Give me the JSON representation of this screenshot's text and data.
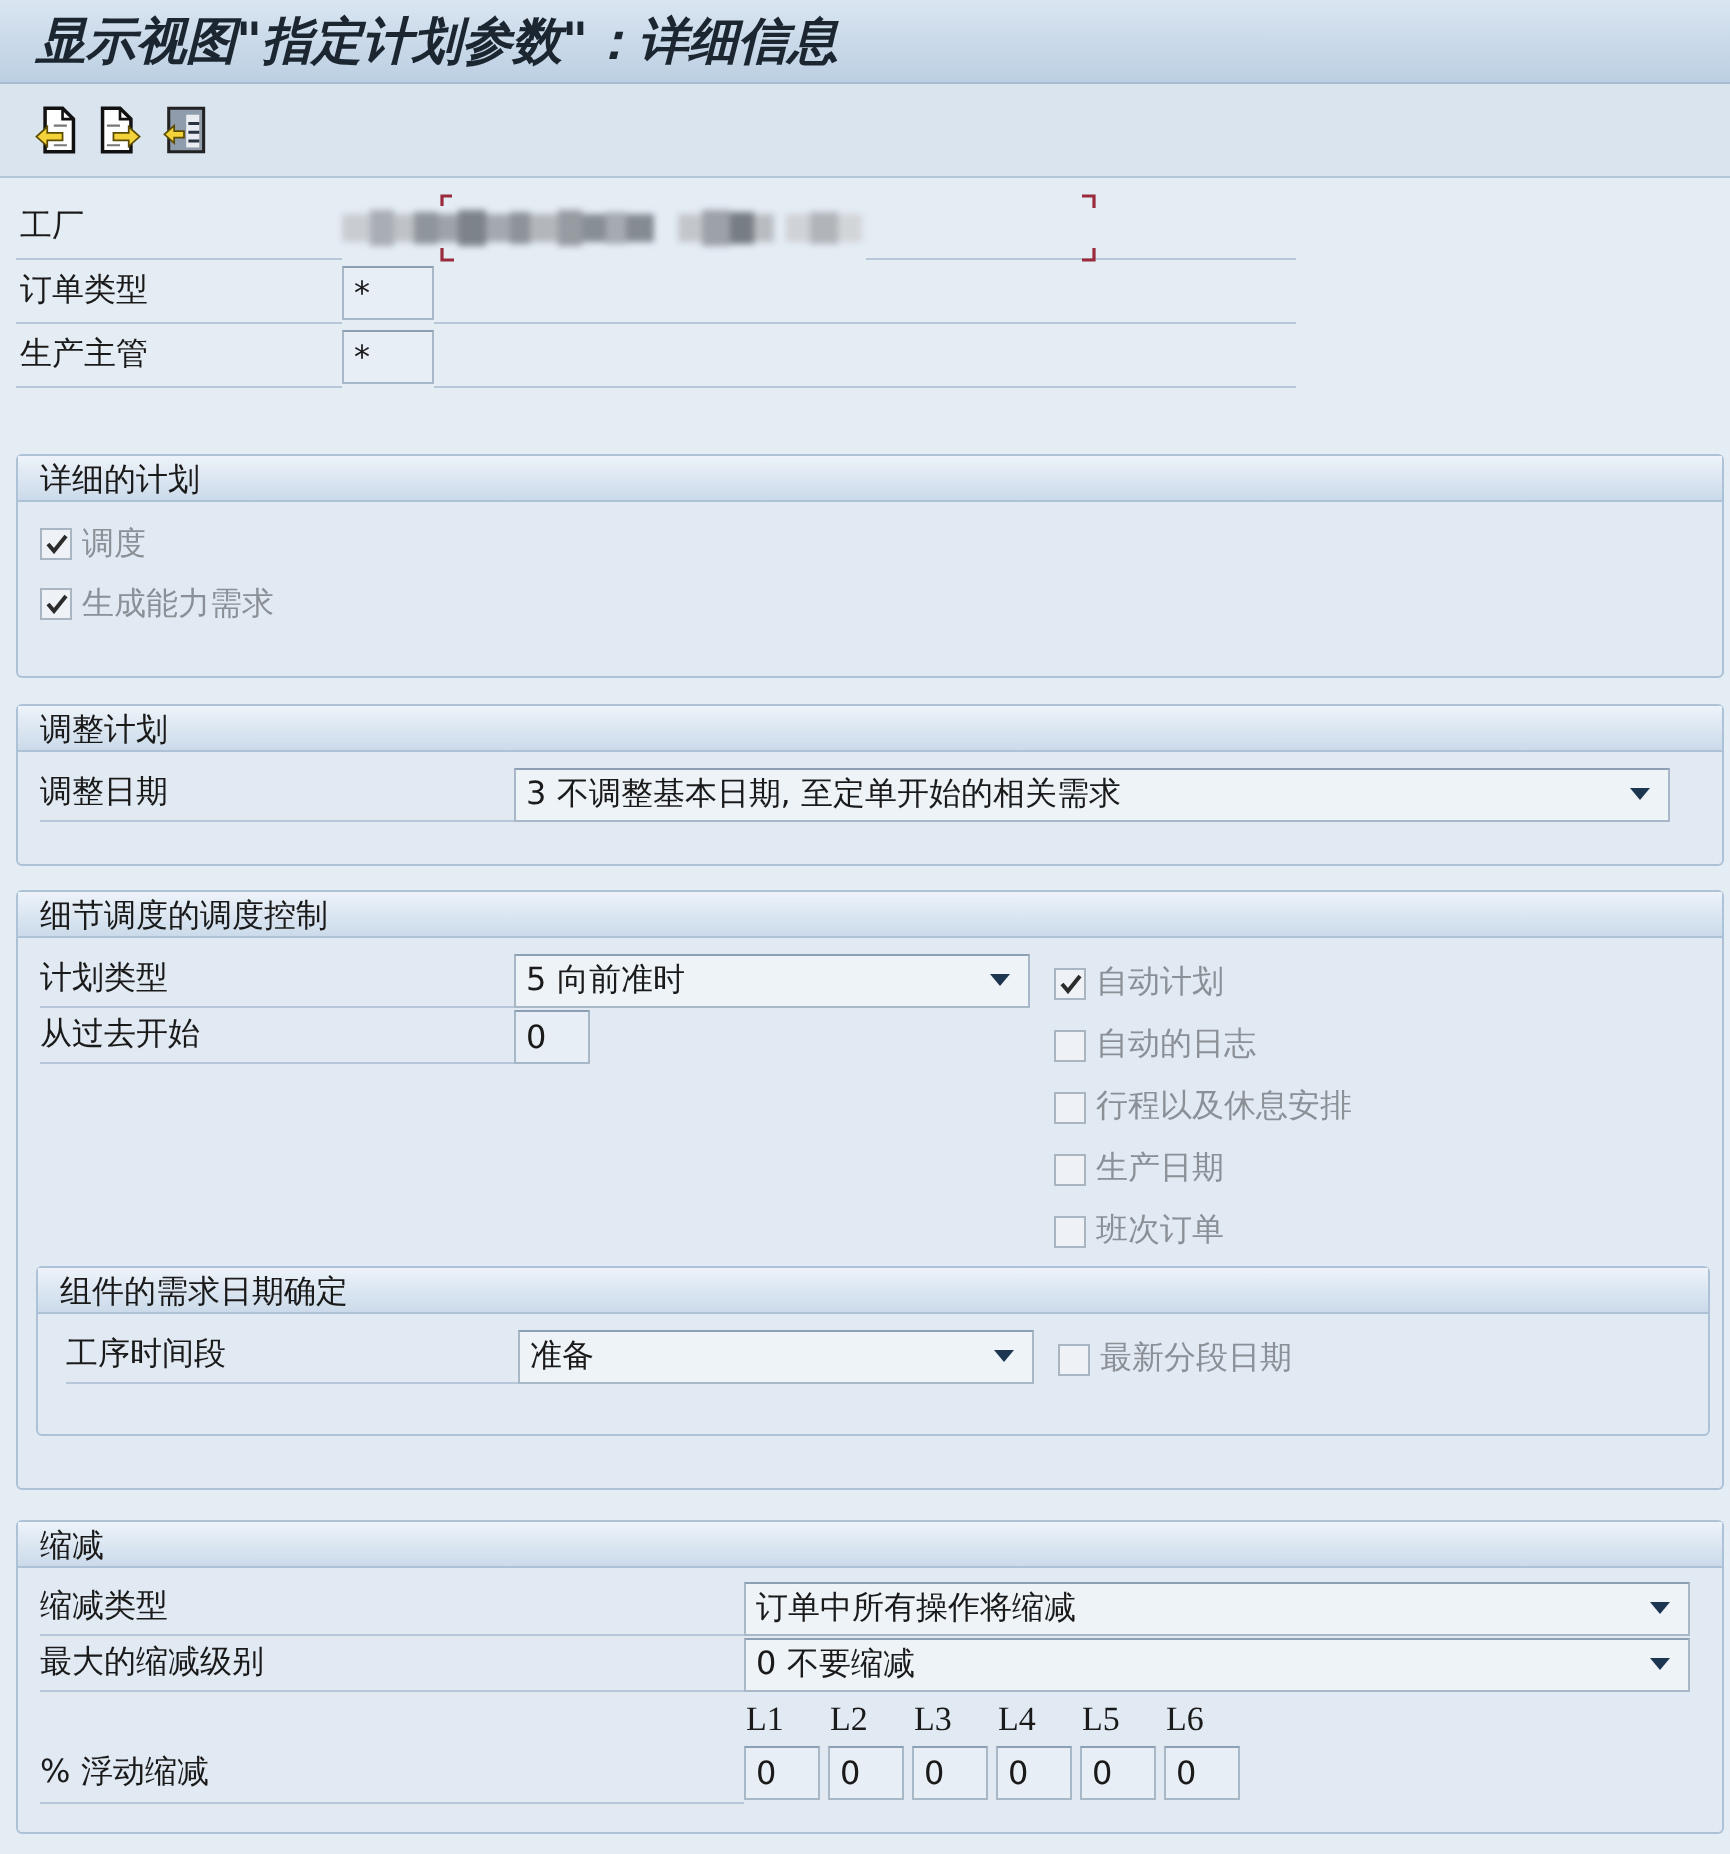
{
  "window": {
    "title": "显示视图\"指定计划参数\"：详细信息"
  },
  "header_fields": [
    {
      "label": "工厂",
      "kind": "redacted"
    },
    {
      "label": "订单类型",
      "kind": "input",
      "value": "*"
    },
    {
      "label": "生产主管",
      "kind": "input",
      "value": "*"
    }
  ],
  "detailed_planning": {
    "title": "详细的计划",
    "checkboxes": [
      {
        "label": "调度",
        "checked": true,
        "disabled": true
      },
      {
        "label": "生成能力需求",
        "checked": true,
        "disabled": true
      }
    ]
  },
  "adjust_planning": {
    "title": "调整计划",
    "fields": [
      {
        "label": "调整日期",
        "kind": "dropdown",
        "value": "3 不调整基本日期, 至定单开始的相关需求"
      }
    ]
  },
  "scheduling_control": {
    "title": "细节调度的调度控制",
    "fields": [
      {
        "label": "计划类型",
        "kind": "dropdown",
        "value": "5 向前准时"
      },
      {
        "label": "从过去开始",
        "kind": "input",
        "value": "0"
      }
    ],
    "checkboxes": [
      {
        "label": "自动计划",
        "checked": true,
        "disabled": true
      },
      {
        "label": "自动的日志",
        "checked": false,
        "disabled": true
      },
      {
        "label": "行程以及休息安排",
        "checked": false,
        "disabled": true
      },
      {
        "label": "生产日期",
        "checked": false,
        "disabled": true
      },
      {
        "label": "班次订单",
        "checked": false,
        "disabled": true
      }
    ],
    "subsection": {
      "title": "组件的需求日期确定",
      "fields": [
        {
          "label": "工序时间段",
          "kind": "dropdown",
          "value": "准备"
        }
      ],
      "checkboxes": [
        {
          "label": "最新分段日期",
          "checked": false,
          "disabled": true
        }
      ]
    }
  },
  "reduction": {
    "title": "缩减",
    "fields": [
      {
        "label": "缩减类型",
        "kind": "dropdown",
        "value": "订单中所有操作将缩减"
      },
      {
        "label": "最大的缩减级别",
        "kind": "dropdown",
        "value": "0 不要缩减"
      }
    ],
    "float_reduction": {
      "label": "% 浮动缩减",
      "levels": [
        {
          "heading": "L1",
          "value": "0"
        },
        {
          "heading": "L2",
          "value": "0"
        },
        {
          "heading": "L3",
          "value": "0"
        },
        {
          "heading": "L4",
          "value": "0"
        },
        {
          "heading": "L5",
          "value": "0"
        },
        {
          "heading": "L6",
          "value": "0"
        }
      ]
    }
  }
}
